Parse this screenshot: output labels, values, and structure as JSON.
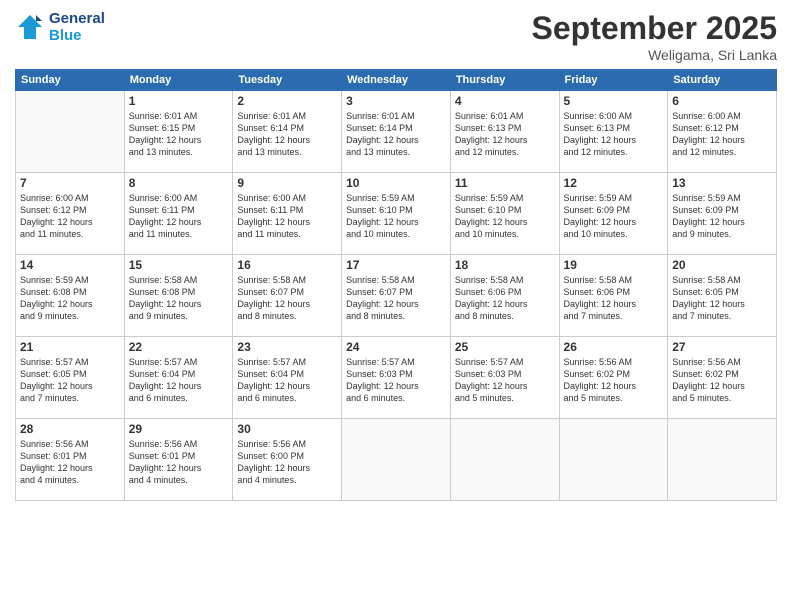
{
  "logo": {
    "line1": "General",
    "line2": "Blue"
  },
  "title": "September 2025",
  "location": "Weligama, Sri Lanka",
  "days_header": [
    "Sunday",
    "Monday",
    "Tuesday",
    "Wednesday",
    "Thursday",
    "Friday",
    "Saturday"
  ],
  "weeks": [
    [
      {
        "num": "",
        "info": ""
      },
      {
        "num": "1",
        "info": "Sunrise: 6:01 AM\nSunset: 6:15 PM\nDaylight: 12 hours\nand 13 minutes."
      },
      {
        "num": "2",
        "info": "Sunrise: 6:01 AM\nSunset: 6:14 PM\nDaylight: 12 hours\nand 13 minutes."
      },
      {
        "num": "3",
        "info": "Sunrise: 6:01 AM\nSunset: 6:14 PM\nDaylight: 12 hours\nand 13 minutes."
      },
      {
        "num": "4",
        "info": "Sunrise: 6:01 AM\nSunset: 6:13 PM\nDaylight: 12 hours\nand 12 minutes."
      },
      {
        "num": "5",
        "info": "Sunrise: 6:00 AM\nSunset: 6:13 PM\nDaylight: 12 hours\nand 12 minutes."
      },
      {
        "num": "6",
        "info": "Sunrise: 6:00 AM\nSunset: 6:12 PM\nDaylight: 12 hours\nand 12 minutes."
      }
    ],
    [
      {
        "num": "7",
        "info": "Sunrise: 6:00 AM\nSunset: 6:12 PM\nDaylight: 12 hours\nand 11 minutes."
      },
      {
        "num": "8",
        "info": "Sunrise: 6:00 AM\nSunset: 6:11 PM\nDaylight: 12 hours\nand 11 minutes."
      },
      {
        "num": "9",
        "info": "Sunrise: 6:00 AM\nSunset: 6:11 PM\nDaylight: 12 hours\nand 11 minutes."
      },
      {
        "num": "10",
        "info": "Sunrise: 5:59 AM\nSunset: 6:10 PM\nDaylight: 12 hours\nand 10 minutes."
      },
      {
        "num": "11",
        "info": "Sunrise: 5:59 AM\nSunset: 6:10 PM\nDaylight: 12 hours\nand 10 minutes."
      },
      {
        "num": "12",
        "info": "Sunrise: 5:59 AM\nSunset: 6:09 PM\nDaylight: 12 hours\nand 10 minutes."
      },
      {
        "num": "13",
        "info": "Sunrise: 5:59 AM\nSunset: 6:09 PM\nDaylight: 12 hours\nand 9 minutes."
      }
    ],
    [
      {
        "num": "14",
        "info": "Sunrise: 5:59 AM\nSunset: 6:08 PM\nDaylight: 12 hours\nand 9 minutes."
      },
      {
        "num": "15",
        "info": "Sunrise: 5:58 AM\nSunset: 6:08 PM\nDaylight: 12 hours\nand 9 minutes."
      },
      {
        "num": "16",
        "info": "Sunrise: 5:58 AM\nSunset: 6:07 PM\nDaylight: 12 hours\nand 8 minutes."
      },
      {
        "num": "17",
        "info": "Sunrise: 5:58 AM\nSunset: 6:07 PM\nDaylight: 12 hours\nand 8 minutes."
      },
      {
        "num": "18",
        "info": "Sunrise: 5:58 AM\nSunset: 6:06 PM\nDaylight: 12 hours\nand 8 minutes."
      },
      {
        "num": "19",
        "info": "Sunrise: 5:58 AM\nSunset: 6:06 PM\nDaylight: 12 hours\nand 7 minutes."
      },
      {
        "num": "20",
        "info": "Sunrise: 5:58 AM\nSunset: 6:05 PM\nDaylight: 12 hours\nand 7 minutes."
      }
    ],
    [
      {
        "num": "21",
        "info": "Sunrise: 5:57 AM\nSunset: 6:05 PM\nDaylight: 12 hours\nand 7 minutes."
      },
      {
        "num": "22",
        "info": "Sunrise: 5:57 AM\nSunset: 6:04 PM\nDaylight: 12 hours\nand 6 minutes."
      },
      {
        "num": "23",
        "info": "Sunrise: 5:57 AM\nSunset: 6:04 PM\nDaylight: 12 hours\nand 6 minutes."
      },
      {
        "num": "24",
        "info": "Sunrise: 5:57 AM\nSunset: 6:03 PM\nDaylight: 12 hours\nand 6 minutes."
      },
      {
        "num": "25",
        "info": "Sunrise: 5:57 AM\nSunset: 6:03 PM\nDaylight: 12 hours\nand 5 minutes."
      },
      {
        "num": "26",
        "info": "Sunrise: 5:56 AM\nSunset: 6:02 PM\nDaylight: 12 hours\nand 5 minutes."
      },
      {
        "num": "27",
        "info": "Sunrise: 5:56 AM\nSunset: 6:02 PM\nDaylight: 12 hours\nand 5 minutes."
      }
    ],
    [
      {
        "num": "28",
        "info": "Sunrise: 5:56 AM\nSunset: 6:01 PM\nDaylight: 12 hours\nand 4 minutes."
      },
      {
        "num": "29",
        "info": "Sunrise: 5:56 AM\nSunset: 6:01 PM\nDaylight: 12 hours\nand 4 minutes."
      },
      {
        "num": "30",
        "info": "Sunrise: 5:56 AM\nSunset: 6:00 PM\nDaylight: 12 hours\nand 4 minutes."
      },
      {
        "num": "",
        "info": ""
      },
      {
        "num": "",
        "info": ""
      },
      {
        "num": "",
        "info": ""
      },
      {
        "num": "",
        "info": ""
      }
    ]
  ]
}
